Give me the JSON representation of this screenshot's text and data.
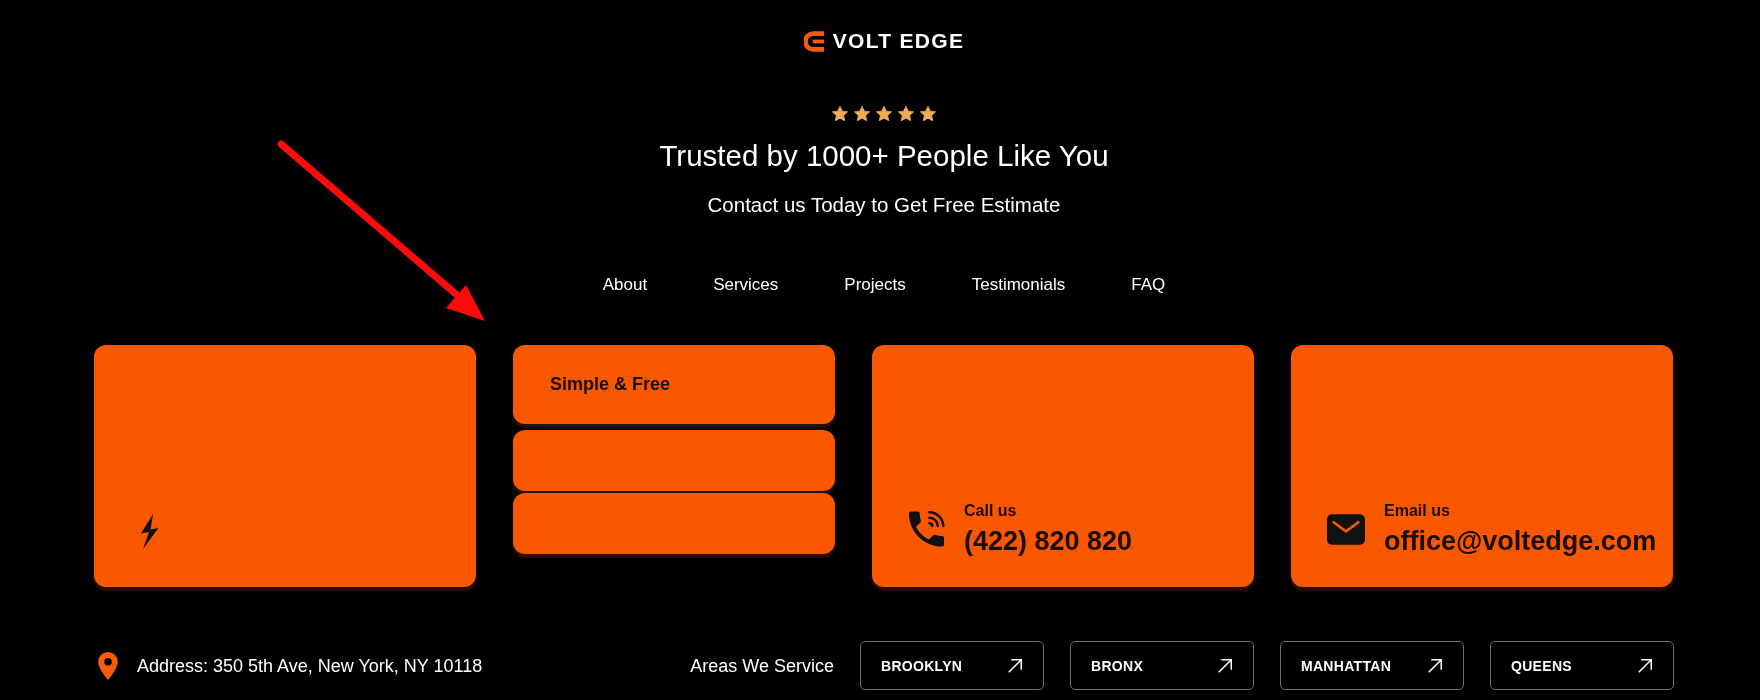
{
  "header": {
    "logo": "VOLT EDGE",
    "rating": {
      "stars": 5
    },
    "title": "Trusted by 1000+ People Like You",
    "subtitle": "Contact us Today to Get Free Estimate"
  },
  "nav": [
    {
      "label": "About"
    },
    {
      "label": "Services"
    },
    {
      "label": "Projects"
    },
    {
      "label": "Testimonials"
    },
    {
      "label": "FAQ"
    }
  ],
  "cards": [
    {
      "kind": "bolt"
    },
    {
      "kind": "stack",
      "title": "Simple & Free"
    },
    {
      "kind": "phone",
      "label": "Call us",
      "value": "(422) 820 820"
    },
    {
      "kind": "email",
      "label": "Email us",
      "value": "office@voltedge.com"
    }
  ],
  "footer": {
    "address": "Address: 350 5th Ave, New York, NY 10118",
    "areas_label": "Areas We Service",
    "areas": [
      {
        "label": "BROOKLYN"
      },
      {
        "label": "BRONX"
      },
      {
        "label": "MANHATTAN"
      },
      {
        "label": "QUEENS"
      }
    ]
  }
}
